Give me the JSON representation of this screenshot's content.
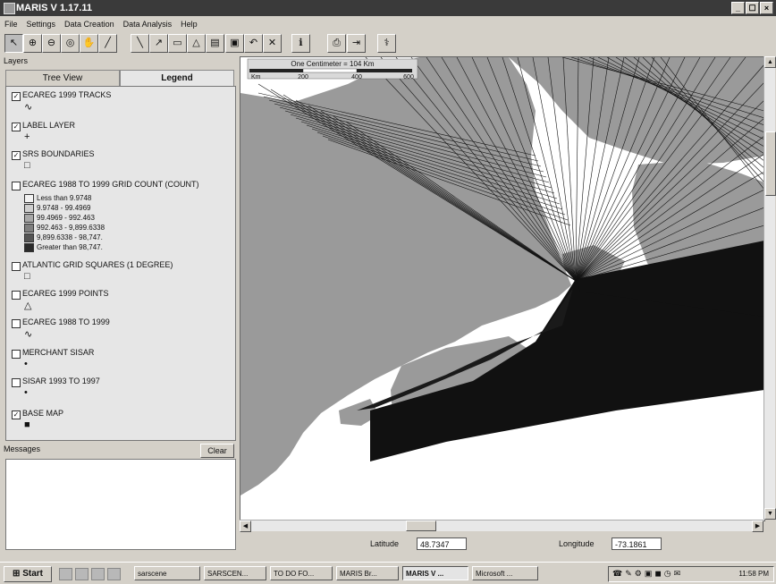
{
  "window": {
    "title": "MARIS V 1.17.11",
    "controls": [
      "_",
      "☐",
      "×"
    ]
  },
  "menu": [
    "File",
    "Settings",
    "Data Creation",
    "Data Analysis",
    "Help"
  ],
  "toolbar": [
    {
      "icon": "arrow-select-icon",
      "glyph": "↖",
      "active": true
    },
    {
      "icon": "zoom-in-icon",
      "glyph": "⊕"
    },
    {
      "icon": "zoom-out-icon",
      "glyph": "⊖"
    },
    {
      "icon": "zoom-area-icon",
      "glyph": "◎"
    },
    {
      "icon": "pan-icon",
      "glyph": "✋"
    },
    {
      "icon": "measure-icon",
      "glyph": "╱"
    },
    {
      "icon": "draw-line-icon",
      "glyph": "╲"
    },
    {
      "icon": "draw-polyline-icon",
      "glyph": "↗"
    },
    {
      "icon": "draw-rectangle-icon",
      "glyph": "▭"
    },
    {
      "icon": "draw-polygon-icon",
      "glyph": "△"
    },
    {
      "icon": "text-box-icon",
      "glyph": "▤"
    },
    {
      "icon": "save-icon",
      "glyph": "▣"
    },
    {
      "icon": "undo-icon",
      "glyph": "↶"
    },
    {
      "icon": "delete-icon",
      "glyph": "✕"
    },
    {
      "icon": "info-icon",
      "glyph": "ℹ"
    },
    {
      "icon": "print-icon",
      "glyph": "⎙"
    },
    {
      "icon": "export-icon",
      "glyph": "⇥"
    },
    {
      "icon": "tool-icon",
      "glyph": "⚕"
    }
  ],
  "layers_label": "Layers",
  "tabs": [
    {
      "label": "Tree View",
      "active": false
    },
    {
      "label": "Legend",
      "active": true
    }
  ],
  "layers": [
    {
      "name": "ECAREG 1999 TRACKS",
      "checked": true,
      "symbol": "track-line-icon",
      "glyph": "∿"
    },
    {
      "name": "LABEL LAYER",
      "checked": true,
      "symbol": "label-cross-icon",
      "glyph": "+"
    },
    {
      "name": "SRS BOUNDARIES",
      "checked": true,
      "symbol": "boundary-box-icon",
      "glyph": "□"
    },
    {
      "name": "ECAREG 1988 TO 1999 GRID COUNT (COUNT)",
      "checked": false
    },
    {
      "name": "ATLANTIC GRID SQUARES (1 DEGREE)",
      "checked": false,
      "symbol": "grid-square-icon",
      "glyph": "□"
    },
    {
      "name": "ECAREG 1999 POINTS",
      "checked": false,
      "symbol": "triangle-point-icon",
      "glyph": "△"
    },
    {
      "name": "ECAREG 1988 TO 1999",
      "checked": false,
      "symbol": "track-line-icon",
      "glyph": "∿"
    },
    {
      "name": "MERCHANT SISAR",
      "checked": false,
      "symbol": "dot-point-icon",
      "glyph": "•"
    },
    {
      "name": "SISAR 1993 TO 1997",
      "checked": false,
      "symbol": "dot-point-icon",
      "glyph": "•"
    },
    {
      "name": "BASE MAP",
      "checked": true,
      "symbol": "fill-box-icon",
      "glyph": "■"
    }
  ],
  "grid_count_classes": [
    {
      "label": "Less than 9.9748",
      "color": "#f2f2f2"
    },
    {
      "label": "9.9748 - 99.4969",
      "color": "#cfcfcf"
    },
    {
      "label": "99.4969 - 992.463",
      "color": "#a8a8a8"
    },
    {
      "label": "992.463 - 9,899.6338",
      "color": "#808080"
    },
    {
      "label": "9,899.6338 - 98,747.",
      "color": "#555555"
    },
    {
      "label": "Greater than 98,747.",
      "color": "#2b2b2b"
    }
  ],
  "messages": {
    "label": "Messages",
    "clear_label": "Clear"
  },
  "scalebar": {
    "title": "One Centimeter = 104 Km",
    "unit": "Km",
    "ticks": [
      "200",
      "400",
      "600"
    ]
  },
  "coords": {
    "lat_label": "Latitude",
    "lat_value": "48.7347",
    "lon_label": "Longitude",
    "lon_value": "-73.1861"
  },
  "taskbar": {
    "start": "Start",
    "tasks": [
      {
        "label": "sarscene",
        "active": false
      },
      {
        "label": "SARSCEN...",
        "active": false
      },
      {
        "label": "TO DO FO...",
        "active": false
      },
      {
        "label": "MARIS Br...",
        "active": false
      },
      {
        "label": "MARIS V ...",
        "active": true
      },
      {
        "label": "Microsoft ...",
        "active": false
      }
    ],
    "clock": "11:58 PM"
  },
  "colors": {
    "land": "#9a9a9a",
    "water": "#ffffff",
    "tracks": "#111111"
  }
}
